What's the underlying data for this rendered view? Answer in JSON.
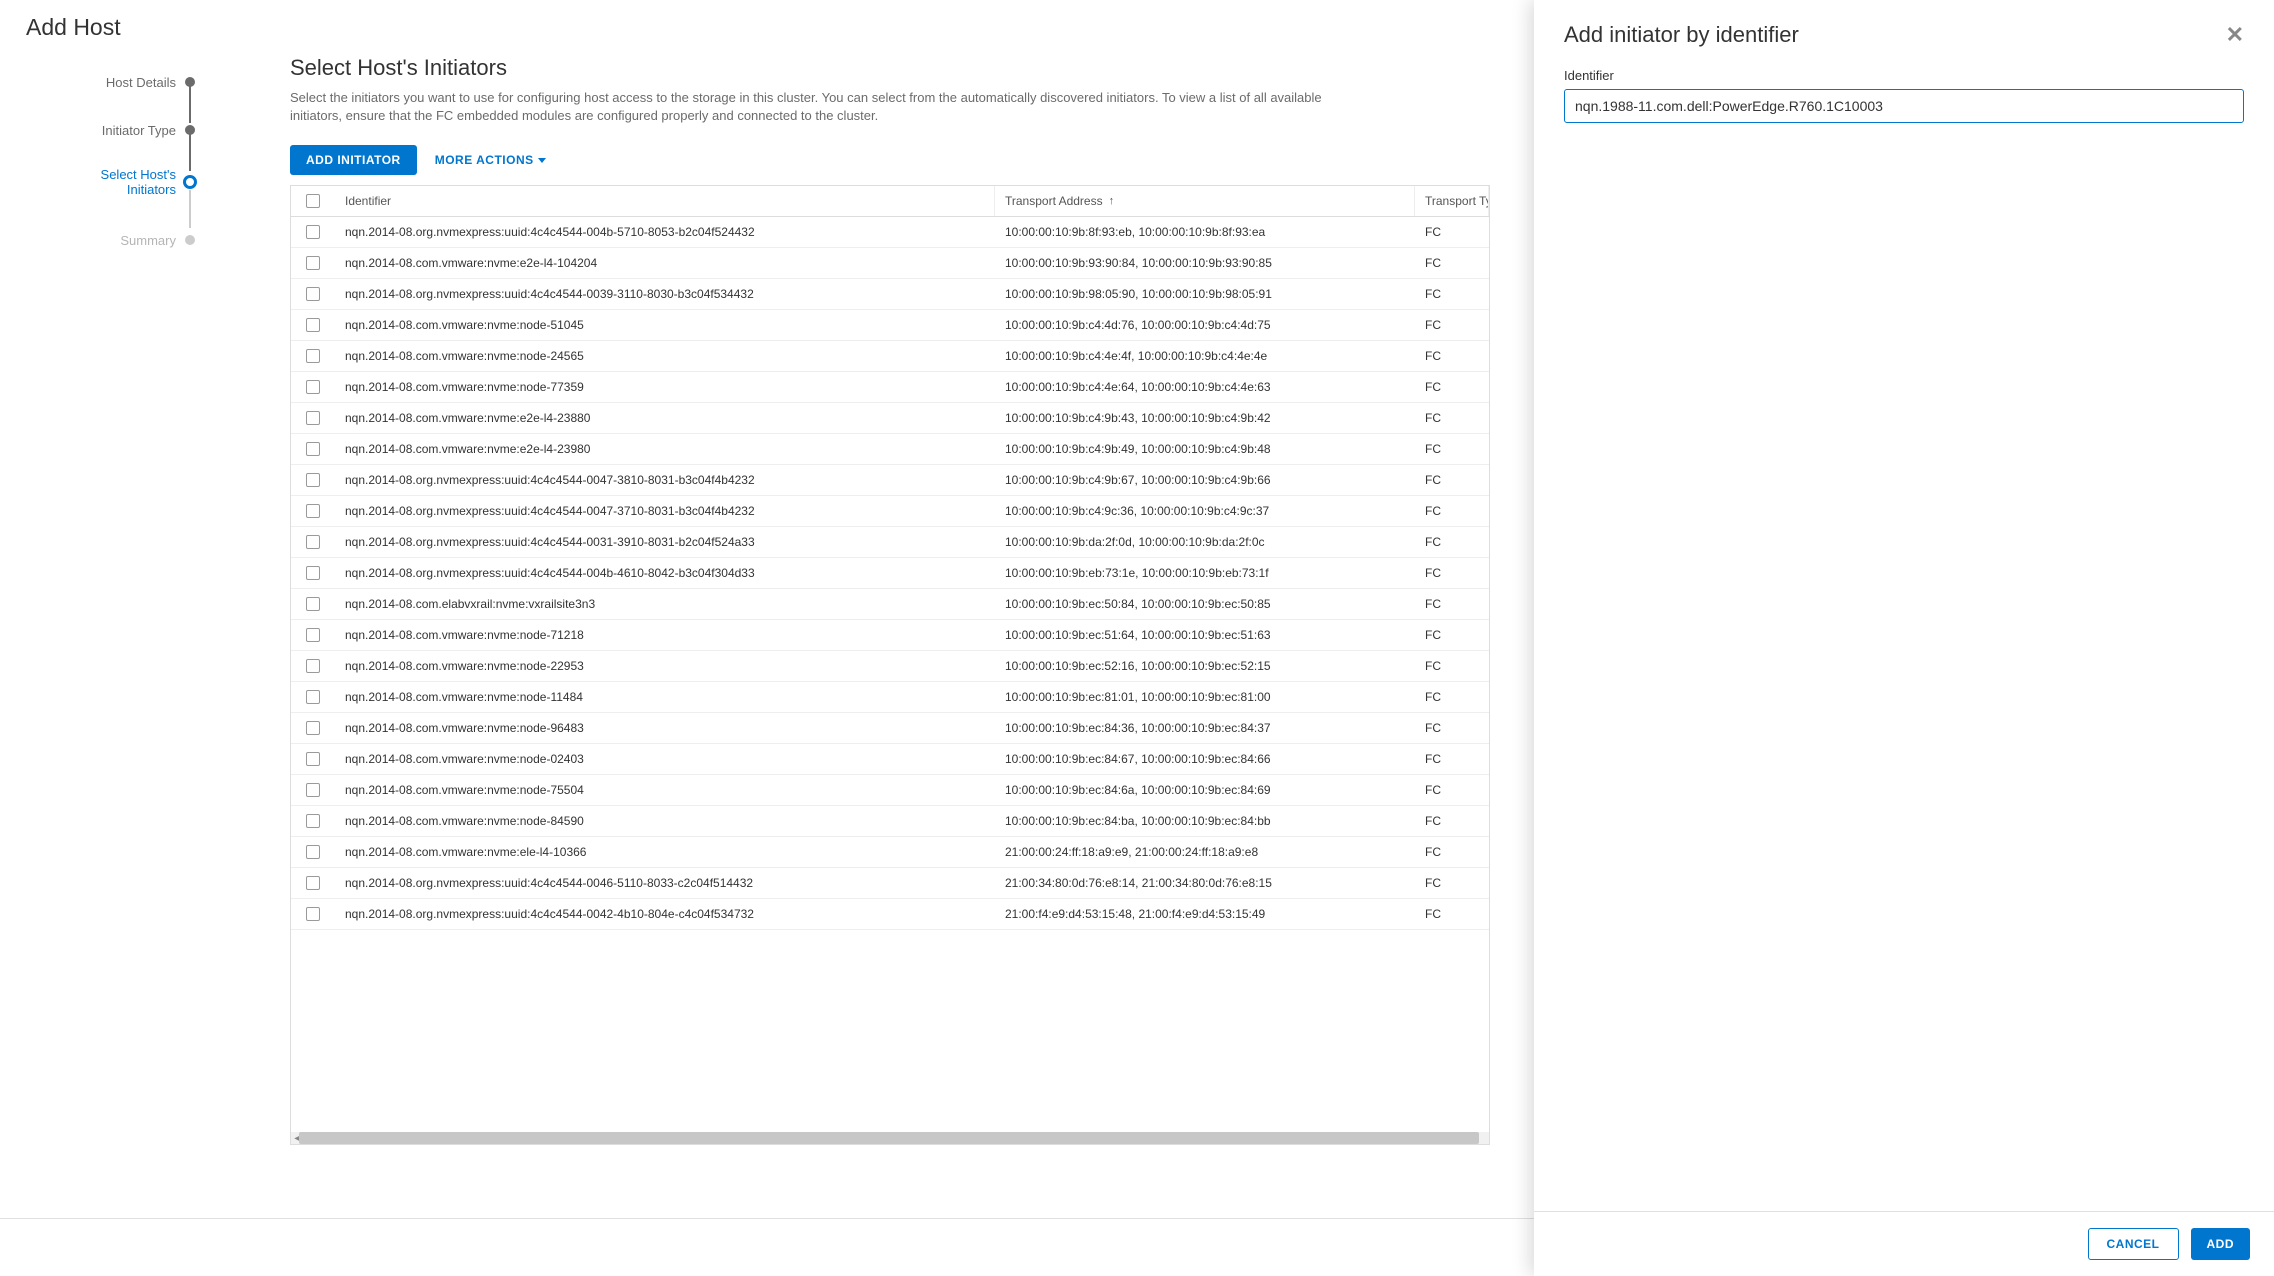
{
  "page": {
    "title": "Add Host"
  },
  "stepper": {
    "steps": [
      {
        "label": "Host Details",
        "state": "done"
      },
      {
        "label": "Initiator Type",
        "state": "done"
      },
      {
        "label": "Select Host's Initiators",
        "state": "active"
      },
      {
        "label": "Summary",
        "state": "future"
      }
    ]
  },
  "content": {
    "title": "Select Host's Initiators",
    "description": "Select the initiators you want to use for configuring host access to the storage in this cluster. You can select from the automatically discovered initiators. To view a list of all available initiators, ensure that the FC embedded modules are configured properly and connected to the cluster."
  },
  "toolbar": {
    "add_initiator": "ADD INITIATOR",
    "more_actions": "MORE ACTIONS"
  },
  "table": {
    "headers": {
      "identifier": "Identifier",
      "transport_address": "Transport Address",
      "transport_type": "Transport Ty"
    },
    "rows": [
      {
        "id": "nqn.2014-08.org.nvmexpress:uuid:4c4c4544-004b-5710-8053-b2c04f524432",
        "addr": "10:00:00:10:9b:8f:93:eb, 10:00:00:10:9b:8f:93:ea",
        "type": "FC"
      },
      {
        "id": "nqn.2014-08.com.vmware:nvme:e2e-l4-104204",
        "addr": "10:00:00:10:9b:93:90:84, 10:00:00:10:9b:93:90:85",
        "type": "FC"
      },
      {
        "id": "nqn.2014-08.org.nvmexpress:uuid:4c4c4544-0039-3110-8030-b3c04f534432",
        "addr": "10:00:00:10:9b:98:05:90, 10:00:00:10:9b:98:05:91",
        "type": "FC"
      },
      {
        "id": "nqn.2014-08.com.vmware:nvme:node-51045",
        "addr": "10:00:00:10:9b:c4:4d:76, 10:00:00:10:9b:c4:4d:75",
        "type": "FC"
      },
      {
        "id": "nqn.2014-08.com.vmware:nvme:node-24565",
        "addr": "10:00:00:10:9b:c4:4e:4f, 10:00:00:10:9b:c4:4e:4e",
        "type": "FC"
      },
      {
        "id": "nqn.2014-08.com.vmware:nvme:node-77359",
        "addr": "10:00:00:10:9b:c4:4e:64, 10:00:00:10:9b:c4:4e:63",
        "type": "FC"
      },
      {
        "id": "nqn.2014-08.com.vmware:nvme:e2e-l4-23880",
        "addr": "10:00:00:10:9b:c4:9b:43, 10:00:00:10:9b:c4:9b:42",
        "type": "FC"
      },
      {
        "id": "nqn.2014-08.com.vmware:nvme:e2e-l4-23980",
        "addr": "10:00:00:10:9b:c4:9b:49, 10:00:00:10:9b:c4:9b:48",
        "type": "FC"
      },
      {
        "id": "nqn.2014-08.org.nvmexpress:uuid:4c4c4544-0047-3810-8031-b3c04f4b4232",
        "addr": "10:00:00:10:9b:c4:9b:67, 10:00:00:10:9b:c4:9b:66",
        "type": "FC"
      },
      {
        "id": "nqn.2014-08.org.nvmexpress:uuid:4c4c4544-0047-3710-8031-b3c04f4b4232",
        "addr": "10:00:00:10:9b:c4:9c:36, 10:00:00:10:9b:c4:9c:37",
        "type": "FC"
      },
      {
        "id": "nqn.2014-08.org.nvmexpress:uuid:4c4c4544-0031-3910-8031-b2c04f524a33",
        "addr": "10:00:00:10:9b:da:2f:0d, 10:00:00:10:9b:da:2f:0c",
        "type": "FC"
      },
      {
        "id": "nqn.2014-08.org.nvmexpress:uuid:4c4c4544-004b-4610-8042-b3c04f304d33",
        "addr": "10:00:00:10:9b:eb:73:1e, 10:00:00:10:9b:eb:73:1f",
        "type": "FC"
      },
      {
        "id": "nqn.2014-08.com.elabvxrail:nvme:vxrailsite3n3",
        "addr": "10:00:00:10:9b:ec:50:84, 10:00:00:10:9b:ec:50:85",
        "type": "FC"
      },
      {
        "id": "nqn.2014-08.com.vmware:nvme:node-71218",
        "addr": "10:00:00:10:9b:ec:51:64, 10:00:00:10:9b:ec:51:63",
        "type": "FC"
      },
      {
        "id": "nqn.2014-08.com.vmware:nvme:node-22953",
        "addr": "10:00:00:10:9b:ec:52:16, 10:00:00:10:9b:ec:52:15",
        "type": "FC"
      },
      {
        "id": "nqn.2014-08.com.vmware:nvme:node-11484",
        "addr": "10:00:00:10:9b:ec:81:01, 10:00:00:10:9b:ec:81:00",
        "type": "FC"
      },
      {
        "id": "nqn.2014-08.com.vmware:nvme:node-96483",
        "addr": "10:00:00:10:9b:ec:84:36, 10:00:00:10:9b:ec:84:37",
        "type": "FC"
      },
      {
        "id": "nqn.2014-08.com.vmware:nvme:node-02403",
        "addr": "10:00:00:10:9b:ec:84:67, 10:00:00:10:9b:ec:84:66",
        "type": "FC"
      },
      {
        "id": "nqn.2014-08.com.vmware:nvme:node-75504",
        "addr": "10:00:00:10:9b:ec:84:6a, 10:00:00:10:9b:ec:84:69",
        "type": "FC"
      },
      {
        "id": "nqn.2014-08.com.vmware:nvme:node-84590",
        "addr": "10:00:00:10:9b:ec:84:ba, 10:00:00:10:9b:ec:84:bb",
        "type": "FC"
      },
      {
        "id": "nqn.2014-08.com.vmware:nvme:ele-l4-10366",
        "addr": "21:00:00:24:ff:18:a9:e9, 21:00:00:24:ff:18:a9:e8",
        "type": "FC"
      },
      {
        "id": "nqn.2014-08.org.nvmexpress:uuid:4c4c4544-0046-5110-8033-c2c04f514432",
        "addr": "21:00:34:80:0d:76:e8:14, 21:00:34:80:0d:76:e8:15",
        "type": "FC"
      },
      {
        "id": "nqn.2014-08.org.nvmexpress:uuid:4c4c4544-0042-4b10-804e-c4c04f534732",
        "addr": "21:00:f4:e9:d4:53:15:48, 21:00:f4:e9:d4:53:15:49",
        "type": "FC"
      }
    ]
  },
  "panel": {
    "title": "Add initiator by identifier",
    "field_label": "Identifier",
    "field_value": "nqn.1988-11.com.dell:PowerEdge.R760.1C10003",
    "cancel": "CANCEL",
    "add": "ADD"
  }
}
